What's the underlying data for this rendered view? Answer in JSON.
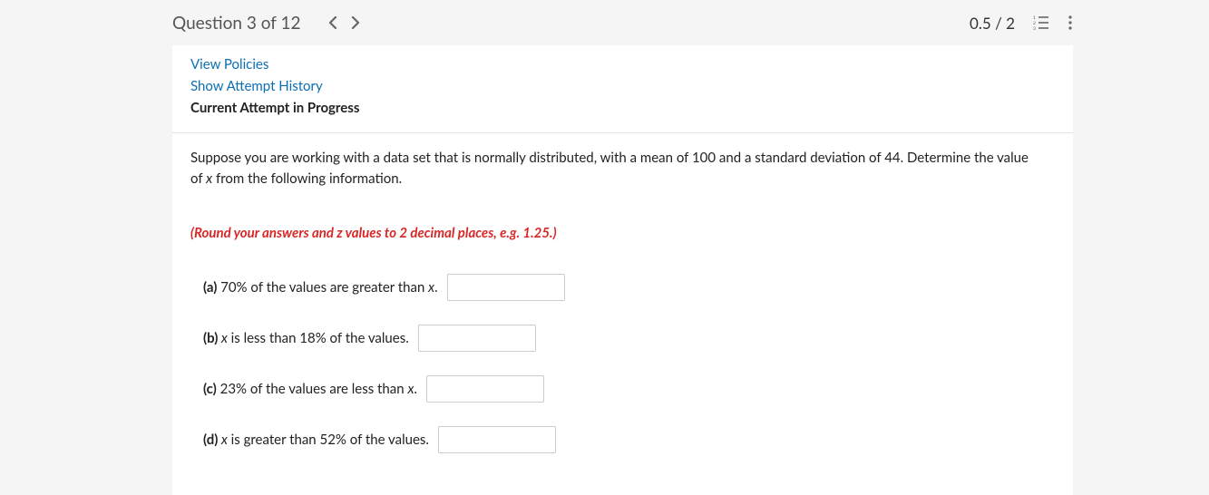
{
  "header": {
    "title": "Question 3 of 12",
    "score": "0.5 / 2"
  },
  "links": {
    "view_policies": "View Policies",
    "show_attempt_history": "Show Attempt History",
    "current_attempt": "Current Attempt in Progress"
  },
  "question": {
    "text_pre": "Suppose you are working with a data set that is normally distributed, with a mean of 100 and a standard deviation of 44. Determine the value of ",
    "text_var": "x",
    "text_post": " from the following information.",
    "rounding": "(Round your answers and z values to 2 decimal places, e.g. 1.25.)"
  },
  "parts": {
    "a": {
      "label_bold": "(a)",
      "text_pre": " 70% of the values are greater than ",
      "text_var": "x",
      "text_post": "."
    },
    "b": {
      "label_bold": "(b)",
      "text_var": " x",
      "text_post": " is less than 18% of the values."
    },
    "c": {
      "label_bold": "(c)",
      "text_pre": " 23% of the values are less than ",
      "text_var": "x",
      "text_post": "."
    },
    "d": {
      "label_bold": "(d)",
      "text_var": " x",
      "text_post": " is greater than 52% of the values."
    }
  }
}
